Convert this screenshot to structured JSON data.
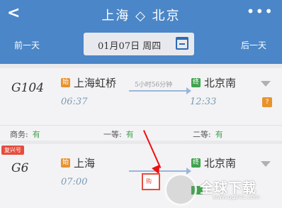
{
  "header": {
    "back_icon": "back-arrow-icon",
    "route_title": "上海 ◇ 北京",
    "more_icon": "more-dots-icon",
    "prev_day": "前一天",
    "next_day": "后一天",
    "date_label": "01月07日 周四",
    "calendar_icon": "calendar-icon"
  },
  "trains": [
    {
      "code": "G104",
      "from_badge": "始",
      "from_station": "上海虹桥",
      "depart_time": "06:37",
      "duration": "5小时56分钟",
      "to_badge": "终",
      "to_station": "北京南",
      "arrive_time": "12:33",
      "extra_icon_text": "?"
    },
    {
      "tag": "复兴号",
      "code": "G6",
      "from_badge": "始",
      "from_station": "上海",
      "depart_time": "07:00",
      "to_badge": "终",
      "to_station": "北京南"
    }
  ],
  "seats": [
    {
      "label": "商务:",
      "value": "有"
    },
    {
      "label": "一等:",
      "value": "有"
    },
    {
      "label": "二等:",
      "value": "有"
    }
  ],
  "popup": {
    "label": "购"
  },
  "watermark": {
    "name": "全球下载",
    "url": "www.qq241.com"
  },
  "colors": {
    "header": "#4a86c8",
    "accent_orange": "#e8922e",
    "accent_green": "#3fa34d",
    "annotation_red": "#e11"
  }
}
